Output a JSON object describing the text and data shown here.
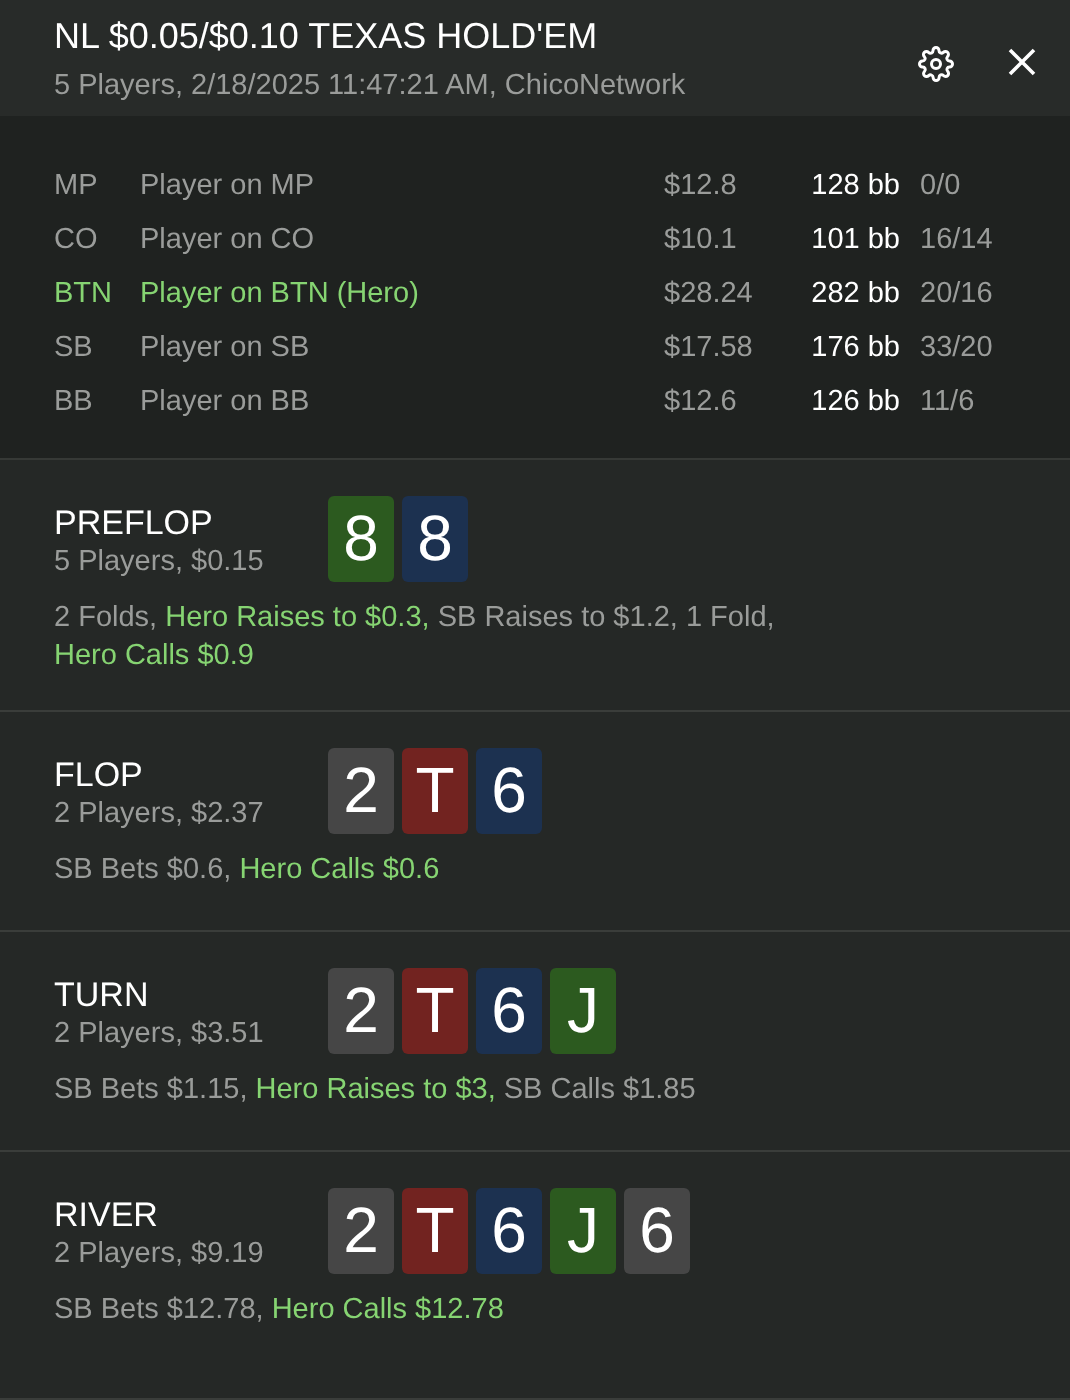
{
  "header": {
    "title": "NL $0.05/$0.10 TEXAS HOLD'EM",
    "subtitle": "5 Players, 2/18/2025 11:47:21 AM, ChicoNetwork"
  },
  "players": [
    {
      "position": "MP",
      "name": "Player on MP",
      "stack": "$12.8",
      "bb": "128 bb",
      "stats": "0/0",
      "hero": false
    },
    {
      "position": "CO",
      "name": "Player on CO",
      "stack": "$10.1",
      "bb": "101 bb",
      "stats": "16/14",
      "hero": false
    },
    {
      "position": "BTN",
      "name": "Player on BTN (Hero)",
      "stack": "$28.24",
      "bb": "282 bb",
      "stats": "20/16",
      "hero": true
    },
    {
      "position": "SB",
      "name": "Player on SB",
      "stack": "$17.58",
      "bb": "176 bb",
      "stats": "33/20",
      "hero": false
    },
    {
      "position": "BB",
      "name": "Player on BB",
      "stack": "$12.6",
      "bb": "126 bb",
      "stats": "11/6",
      "hero": false
    }
  ],
  "streets": [
    {
      "name": "PREFLOP",
      "info": "5 Players, $0.15",
      "cards": [
        {
          "rank": "8",
          "color": "#2c5a1f"
        },
        {
          "rank": "8",
          "color": "#1c3150"
        }
      ],
      "actions": [
        {
          "text": "2 Folds,",
          "hero": false
        },
        {
          "text": "Hero Raises to $0.3,",
          "hero": true
        },
        {
          "text": "SB Raises to $1.2,",
          "hero": false
        },
        {
          "text": "1 Fold,",
          "hero": false
        },
        {
          "text": "Hero Calls $0.9",
          "hero": true
        }
      ]
    },
    {
      "name": "FLOP",
      "info": "2 Players, $2.37",
      "cards": [
        {
          "rank": "2",
          "color": "#464646"
        },
        {
          "rank": "T",
          "color": "#722320"
        },
        {
          "rank": "6",
          "color": "#1c3150"
        }
      ],
      "actions": [
        {
          "text": "SB Bets $0.6,",
          "hero": false
        },
        {
          "text": "Hero Calls $0.6",
          "hero": true
        }
      ]
    },
    {
      "name": "TURN",
      "info": "2 Players, $3.51",
      "cards": [
        {
          "rank": "2",
          "color": "#464646"
        },
        {
          "rank": "T",
          "color": "#722320"
        },
        {
          "rank": "6",
          "color": "#1c3150"
        },
        {
          "rank": "J",
          "color": "#2c5a1f"
        }
      ],
      "actions": [
        {
          "text": "SB Bets $1.15,",
          "hero": false
        },
        {
          "text": "Hero Raises to $3,",
          "hero": true
        },
        {
          "text": "SB Calls $1.85",
          "hero": false
        }
      ]
    },
    {
      "name": "RIVER",
      "info": "2 Players, $9.19",
      "cards": [
        {
          "rank": "2",
          "color": "#464646"
        },
        {
          "rank": "T",
          "color": "#722320"
        },
        {
          "rank": "6",
          "color": "#1c3150"
        },
        {
          "rank": "J",
          "color": "#2c5a1f"
        },
        {
          "rank": "6",
          "color": "#464646"
        }
      ],
      "actions": [
        {
          "text": "SB Bets $12.78,",
          "hero": false
        },
        {
          "text": "Hero Calls $12.78",
          "hero": true
        }
      ]
    }
  ]
}
